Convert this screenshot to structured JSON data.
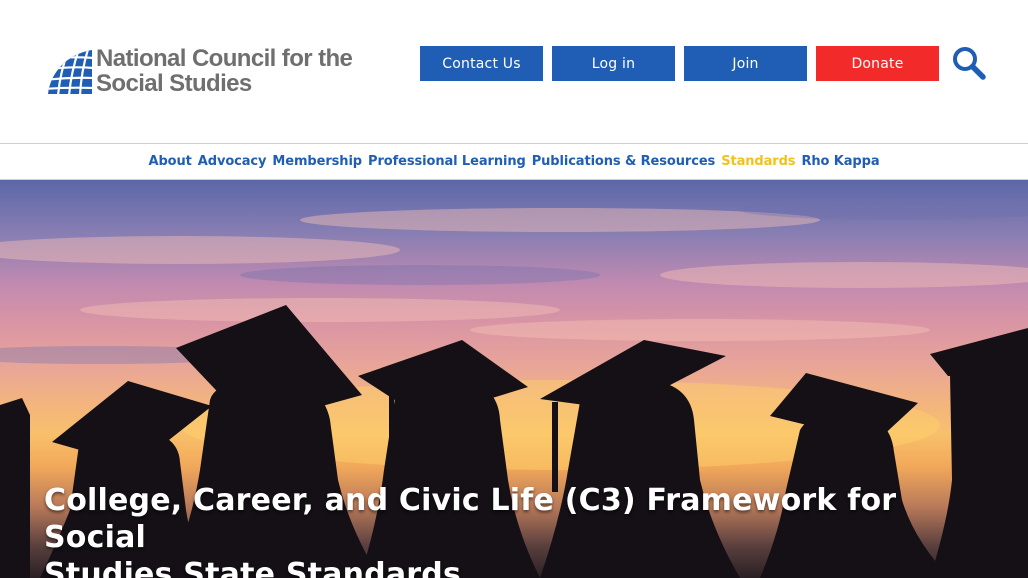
{
  "brand": {
    "name_line1": "National Council for the",
    "name_line2": "Social Studies",
    "logo_icon": "globe-grid-icon",
    "colors": {
      "blue": "#1f5eb4",
      "red": "#f22a2a",
      "active": "#f2c21b",
      "logo_gray": "#6f6f6f"
    }
  },
  "header": {
    "buttons": {
      "contact": "Contact Us",
      "login": "Log in",
      "join": "Join",
      "donate": "Donate"
    },
    "search_icon": "search-icon"
  },
  "nav": {
    "items": [
      {
        "label": "About"
      },
      {
        "label": "Advocacy"
      },
      {
        "label": "Membership"
      },
      {
        "label": "Professional Learning"
      },
      {
        "label": "Publications & Resources"
      },
      {
        "label": "Standards",
        "active": true
      },
      {
        "label": "Rho Kappa"
      }
    ]
  },
  "hero": {
    "title_line1": "College, Career, and Civic Life (C3) Framework for Social",
    "title_line2": "Studies State Standards"
  }
}
